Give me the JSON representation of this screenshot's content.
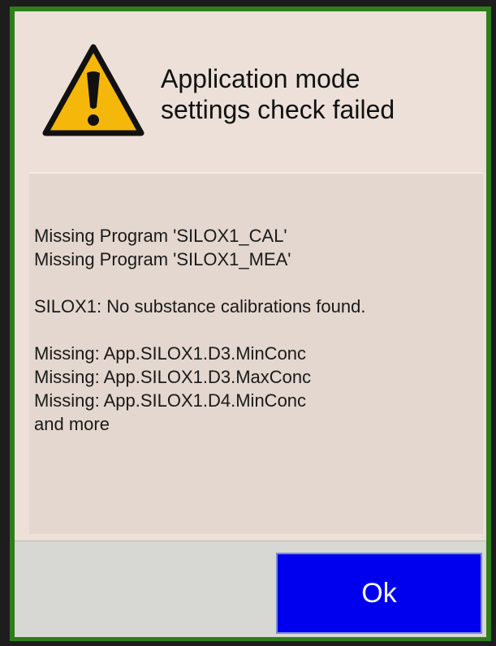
{
  "dialog": {
    "title": "Application mode\nsettings check failed",
    "icon": "warning-triangle-icon",
    "accent_color": "#2f7d1b",
    "message_lines": [
      "Missing Program 'SILOX1_CAL'",
      "Missing Program 'SILOX1_MEA'",
      "",
      "SILOX1: No substance calibrations found.",
      "",
      "Missing: App.SILOX1.D3.MinConc",
      "Missing: App.SILOX1.D3.MaxConc",
      "Missing: App.SILOX1.D4.MinConc",
      "and more"
    ],
    "ok_label": "Ok",
    "ok_color": "#0000ee"
  }
}
